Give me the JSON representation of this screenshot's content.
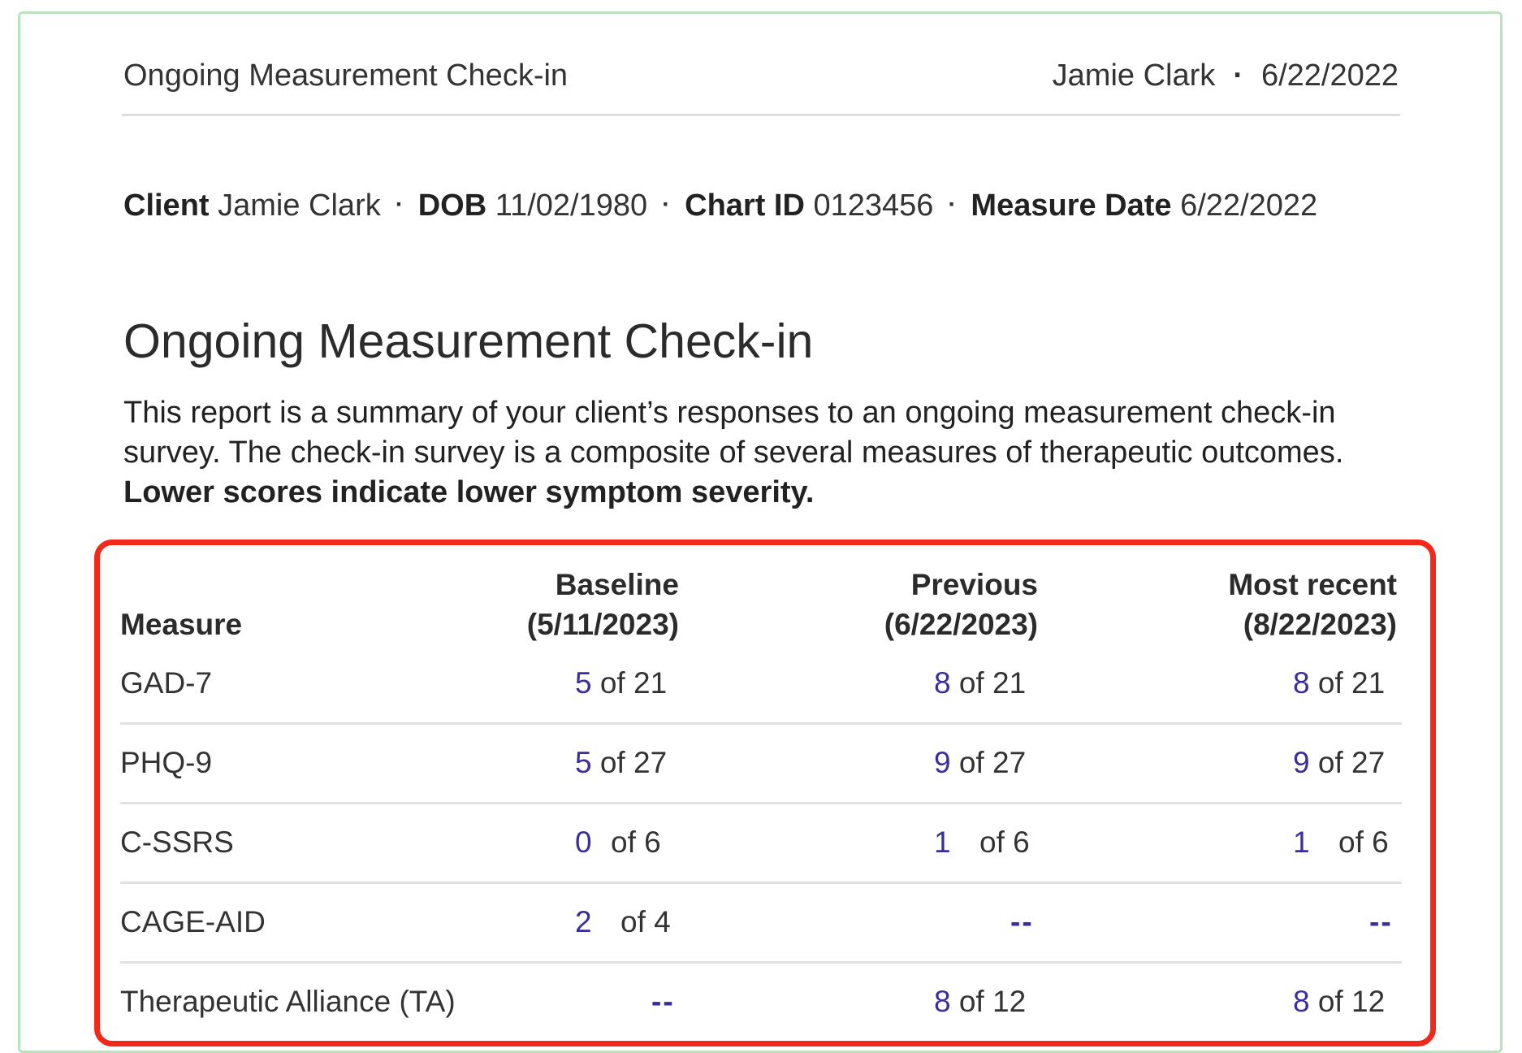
{
  "header": {
    "title": "Ongoing Measurement Check-in",
    "user": "Jamie Clark",
    "separator": "·",
    "date": "6/22/2022"
  },
  "meta": {
    "client_label": "Client",
    "client_value": "Jamie Clark",
    "dob_label": "DOB",
    "dob_value": "11/02/1980",
    "chart_label": "Chart ID",
    "chart_value": "0123456",
    "measure_date_label": "Measure Date",
    "measure_date_value": "6/22/2022",
    "separator": "·"
  },
  "report": {
    "title": "Ongoing Measurement Check-in",
    "description": "This report is a summary of your client’s responses to an ongoing measurement check-in survey. The check-in survey is a composite of several measures of therapeutic outcomes.",
    "emphasis": "Lower scores indicate lower symptom severity."
  },
  "table": {
    "headers": {
      "measure": "Measure",
      "baseline_1": "Baseline",
      "baseline_2": "(5/11/2023)",
      "previous_1": "Previous",
      "previous_2": "(6/22/2023)",
      "recent_1": "Most recent",
      "recent_2": "(8/22/2023)"
    },
    "rows": [
      {
        "measure": "GAD-7",
        "baseline": {
          "score": "5",
          "max": "of 21"
        },
        "previous": {
          "score": "8",
          "max": "of 21"
        },
        "recent": {
          "score": "8",
          "max": "of 21"
        }
      },
      {
        "measure": "PHQ-9",
        "baseline": {
          "score": "5",
          "max": "of 27"
        },
        "previous": {
          "score": "9",
          "max": "of 27"
        },
        "recent": {
          "score": "9",
          "max": "of 27"
        }
      },
      {
        "measure": "C-SSRS",
        "baseline": {
          "score": "0",
          "max": "of 6"
        },
        "previous": {
          "score": "1",
          "max": "of 6"
        },
        "recent": {
          "score": "1",
          "max": "of 6"
        }
      },
      {
        "measure": "CAGE-AID",
        "baseline": {
          "score": "2",
          "max": "of 4"
        },
        "previous": "--",
        "recent": "--"
      },
      {
        "measure": "Therapeutic Alliance (TA)",
        "baseline": "--",
        "previous": {
          "score": "8",
          "max": "of 12"
        },
        "recent": {
          "score": "8",
          "max": "of 12"
        }
      }
    ]
  },
  "colors": {
    "score": "#3a2d9c",
    "highlight_border": "#f2281b",
    "card_border": "#b7e3bd"
  }
}
